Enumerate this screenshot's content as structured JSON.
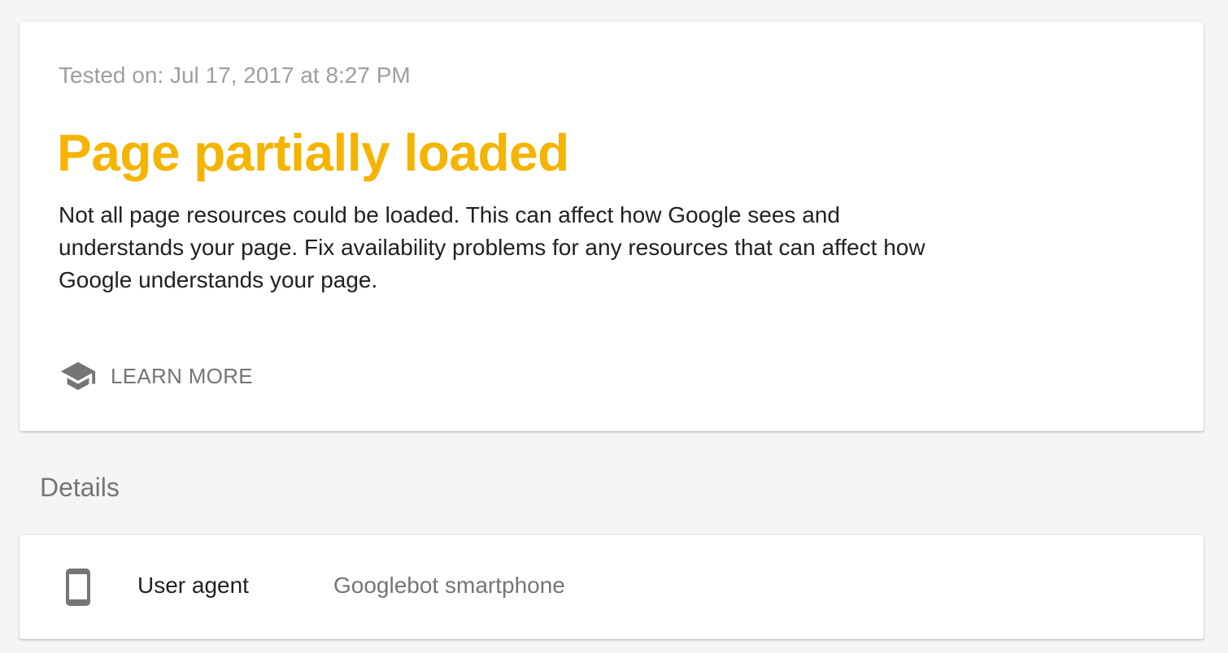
{
  "result": {
    "tested_on": "Tested on: Jul 17, 2017 at 8:27 PM",
    "status_title": "Page partially loaded",
    "status_color": "#f4b400",
    "description": "Not all page resources could be loaded. This can affect how Google sees and understands your page. Fix availability problems for any resources that can affect how Google understands your page.",
    "learn_more": {
      "icon": "school-icon",
      "label": "LEARN MORE"
    }
  },
  "details": {
    "heading": "Details",
    "rows": [
      {
        "icon": "smartphone-icon",
        "key": "User agent",
        "value": "Googlebot smartphone"
      }
    ]
  }
}
